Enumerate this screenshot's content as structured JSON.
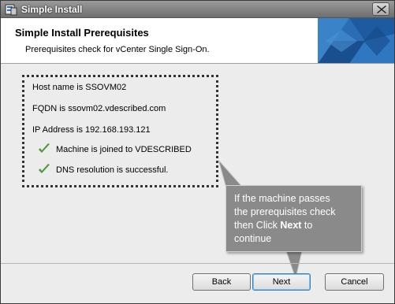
{
  "window": {
    "title": "Simple Install"
  },
  "header": {
    "title": "Simple Install Prerequisites",
    "subtitle": "Prerequisites check for vCenter Single Sign-On."
  },
  "checks": [
    {
      "text": "Host name is SSOVM02",
      "passed": false
    },
    {
      "text": "FQDN is ssovm02.vdescribed.com",
      "passed": false
    },
    {
      "text": "IP Address is 192.168.193.121",
      "passed": false
    },
    {
      "text": "Machine is joined to VDESCRIBED",
      "passed": true
    },
    {
      "text": "DNS resolution is successful.",
      "passed": true
    }
  ],
  "callout": {
    "line1": "If the machine passes",
    "line2": "the prerequisites check",
    "line3_prefix": "then Click ",
    "line3_bold": "Next",
    "line3_suffix": " to",
    "line4": "continue"
  },
  "buttons": {
    "back": "Back",
    "next": "Next",
    "cancel": "Cancel"
  },
  "colors": {
    "check": "#4f9a3a",
    "banner": "#1f5fa8",
    "callout": "#8a8a8a"
  }
}
